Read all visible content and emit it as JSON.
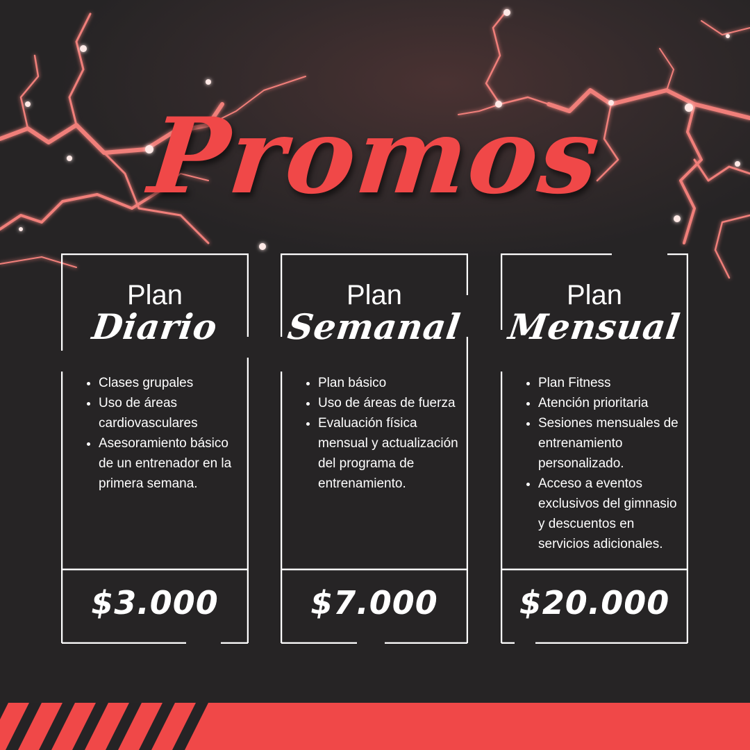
{
  "title": "Promos",
  "colors": {
    "accent": "#f04848",
    "background": "#262425",
    "text": "#ffffff"
  },
  "plans": [
    {
      "label": "Plan",
      "name": "Diario",
      "features": [
        "Clases grupales",
        "Uso de áreas cardiovasculares",
        "Asesoramiento básico de un entrenador en la primera semana."
      ],
      "price": "$3.000"
    },
    {
      "label": "Plan",
      "name": "Semanal",
      "features": [
        "Plan básico",
        "Uso de áreas de fuerza",
        "Evaluación física mensual y actualización del programa de entrenamiento."
      ],
      "price": "$7.000"
    },
    {
      "label": "Plan",
      "name": "Mensual",
      "features": [
        "Plan Fitness",
        "Atención prioritaria",
        "Sesiones mensuales de entrenamiento personalizado.",
        "Acceso a eventos exclusivos del gimnasio y descuentos en servicios adicionales."
      ],
      "price": "$20.000"
    }
  ]
}
